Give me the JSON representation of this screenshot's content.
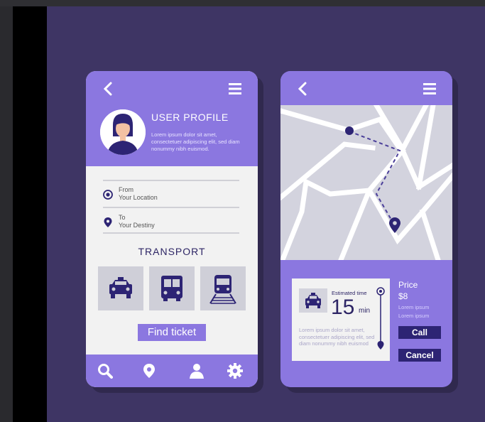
{
  "left_phone": {
    "profile_title": "USER PROFILE",
    "profile_description": "Lorem ipsum dolor sit amet, consectetuer adipiscing elit, sed diam nonummy nibh euismod.",
    "from": {
      "label": "From",
      "value": "Your Location"
    },
    "to": {
      "label": "To",
      "value": "Your Destiny"
    },
    "section_title": "TRANSPORT",
    "transport_options": [
      {
        "icon": "taxi-icon"
      },
      {
        "icon": "bus-icon"
      },
      {
        "icon": "train-icon"
      }
    ],
    "find_button": "Find ticket",
    "nav_icons": [
      "search-icon",
      "location-pin-icon",
      "user-icon",
      "gear-icon"
    ]
  },
  "right_phone": {
    "estimate_label": "Estimated time",
    "estimate_value": "15",
    "estimate_unit": "min",
    "card_description": "Lorem ipsum dolor sit amet, consectetuer adipiscing elit, sed diam nonummy nibh euismod",
    "price_label": "Price",
    "price_value": "$8",
    "price_lines": [
      "Lorem ipsum",
      "Lorem ipsum"
    ],
    "call_button": "Call",
    "cancel_button": "Cancel"
  },
  "colors": {
    "background": "#3e3564",
    "accent": "#8b77e0",
    "dark": "#2d2474",
    "panel": "#f2f2f2"
  }
}
